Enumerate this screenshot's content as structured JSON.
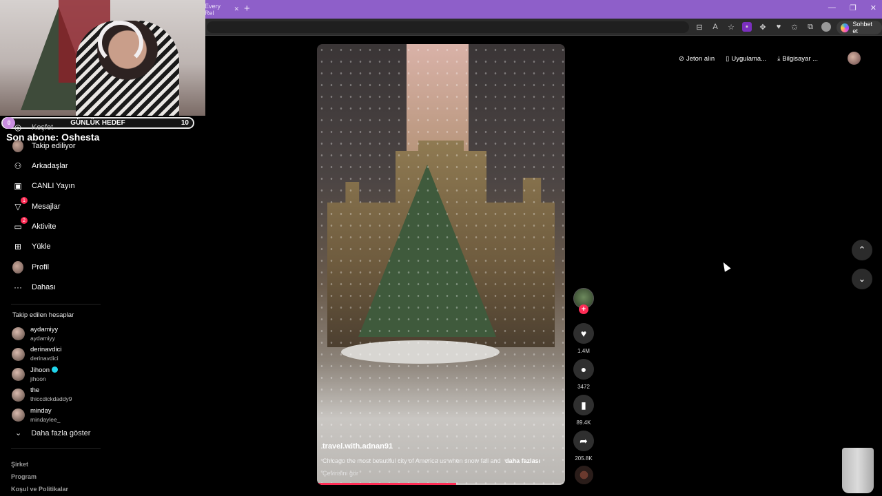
{
  "browser": {
    "tab_partial_title": "Every Rel",
    "new_tab": "+",
    "controls": [
      "—",
      "❐",
      "✕"
    ],
    "sohbet_label": "Sohbet et"
  },
  "stream_overlay": {
    "goal_label": "GÜNLÜK HEDEF",
    "goal_current": "0",
    "goal_target": "10",
    "last_sub": "Son abone: Oshesta"
  },
  "sidebar": {
    "items": [
      {
        "label": "Keşfet",
        "icon": "compass-icon",
        "glyph": "◎"
      },
      {
        "label": "Takip ediliyor",
        "icon": "avatar",
        "glyph": ""
      },
      {
        "label": "Arkadaşlar",
        "icon": "friends-icon",
        "glyph": "👥"
      },
      {
        "label": "CANLI Yayın",
        "icon": "live-icon",
        "glyph": "▣"
      },
      {
        "label": "Mesajlar",
        "icon": "messages-icon",
        "glyph": "✉",
        "badge": "1"
      },
      {
        "label": "Aktivite",
        "icon": "activity-icon",
        "glyph": "▭",
        "badge": "2"
      },
      {
        "label": "Yükle",
        "icon": "upload-icon",
        "glyph": "⊞"
      },
      {
        "label": "Profil",
        "icon": "profile-avatar",
        "glyph": ""
      },
      {
        "label": "Dahası",
        "icon": "more-icon",
        "glyph": "···"
      }
    ],
    "followed_title": "Takip edilen hesaplar",
    "followed": [
      {
        "name": "aydamiyy",
        "handle": "aydamiyy",
        "verified": false
      },
      {
        "name": "derinavdici",
        "handle": "derinavdici",
        "verified": false
      },
      {
        "name": "Jihoon",
        "handle": "jihoon",
        "verified": true
      },
      {
        "name": "the",
        "handle": "thiccdickdaddy9",
        "verified": false
      },
      {
        "name": "minday",
        "handle": "mindaylee_",
        "verified": false
      }
    ],
    "show_more": "Daha fazla göster",
    "footer": [
      "Şirket",
      "Program",
      "Koşul ve Politikalar"
    ]
  },
  "header_actions": {
    "coins": "Jeton alın",
    "app": "Uygulama...",
    "desktop": "Bilgisayar ..."
  },
  "video": {
    "username": "travel.with.adnan91",
    "caption": "Chicago the most beautiful city of America us when snow fall and",
    "more": "daha fazlası",
    "translate": "Çevirisini gör",
    "progress": 0.56
  },
  "actions": {
    "likes": "1.4M",
    "comments": "3472",
    "saves": "89.4K",
    "shares": "205.8K"
  }
}
